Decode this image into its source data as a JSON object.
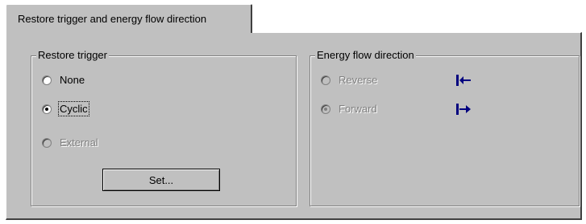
{
  "tab": {
    "label": "Restore trigger and energy flow direction"
  },
  "restore_trigger": {
    "title": "Restore trigger",
    "options": [
      {
        "label": "None",
        "selected": false,
        "enabled": true
      },
      {
        "label": "Cyclic",
        "selected": true,
        "enabled": true
      },
      {
        "label": "External",
        "selected": false,
        "enabled": false
      }
    ],
    "set_button": "Set..."
  },
  "energy_flow": {
    "title": "Energy flow direction",
    "options": [
      {
        "label": "Reverse",
        "selected": false,
        "enabled": false,
        "icon": "arrow-left-to-bar-icon"
      },
      {
        "label": "Forward",
        "selected": true,
        "enabled": false,
        "icon": "arrow-right-to-bar-icon"
      }
    ]
  },
  "colors": {
    "face": "#c0c0c0",
    "arrow": "#00007f"
  }
}
